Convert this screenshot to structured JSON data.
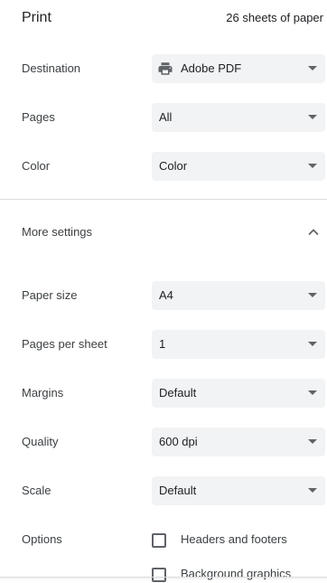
{
  "header": {
    "title": "Print",
    "summary": "26 sheets of paper"
  },
  "basic_settings": {
    "destination": {
      "label": "Destination",
      "value": "Adobe PDF",
      "icon": "printer-icon"
    },
    "pages": {
      "label": "Pages",
      "value": "All"
    },
    "color": {
      "label": "Color",
      "value": "Color"
    }
  },
  "more_settings": {
    "label": "More settings",
    "expanded": true,
    "icon": "chevron-up-icon"
  },
  "advanced_settings": {
    "paper_size": {
      "label": "Paper size",
      "value": "A4"
    },
    "pages_per_sheet": {
      "label": "Pages per sheet",
      "value": "1"
    },
    "margins": {
      "label": "Margins",
      "value": "Default"
    },
    "quality": {
      "label": "Quality",
      "value": "600 dpi"
    },
    "scale": {
      "label": "Scale",
      "value": "Default"
    }
  },
  "options": {
    "label": "Options",
    "items": [
      {
        "label": "Headers and footers",
        "checked": false
      },
      {
        "label": "Background graphics",
        "checked": false
      }
    ]
  },
  "colors": {
    "select_background": "#f1f3f4",
    "text": "#202124",
    "label_text": "#3c4043",
    "icon": "#5f6368",
    "divider": "#dadce0"
  }
}
